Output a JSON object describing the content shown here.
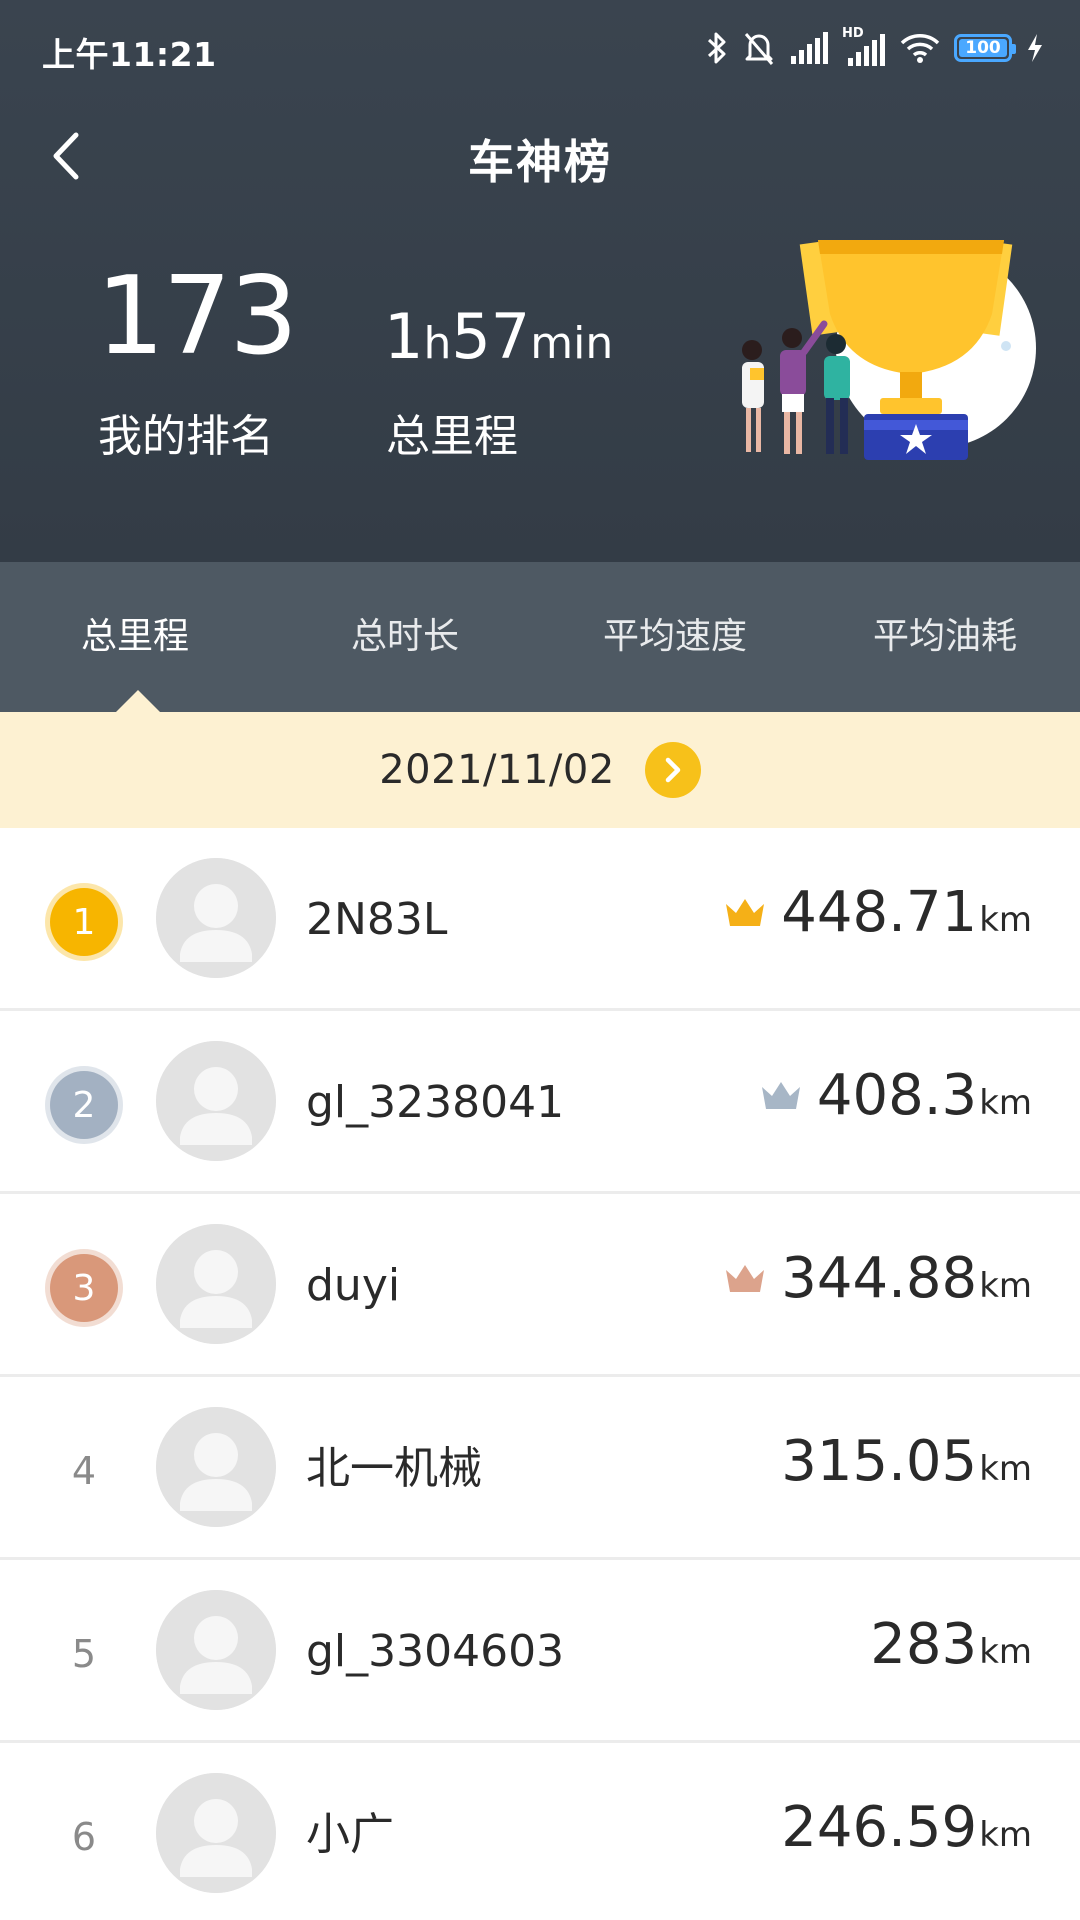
{
  "status_bar": {
    "time": "上午11:21",
    "hd_label": "HD",
    "battery": "100",
    "icons": [
      "bluetooth-icon",
      "mute-icon",
      "signal-icon",
      "hd-signal-icon",
      "wifi-icon",
      "battery-icon",
      "charging-icon"
    ]
  },
  "header": {
    "title": "车神榜",
    "back_icon": "chevron-left-icon"
  },
  "stats": {
    "rank_value": "173",
    "rank_label": "我的排名",
    "time_hours": "1",
    "time_h_unit": "h",
    "time_minutes": "57",
    "time_min_unit": "min",
    "time_label": "总里程"
  },
  "tabs": [
    {
      "label": "总里程",
      "active": true
    },
    {
      "label": "总时长",
      "active": false
    },
    {
      "label": "平均速度",
      "active": false
    },
    {
      "label": "平均油耗",
      "active": false
    }
  ],
  "date_bar": {
    "date": "2021/11/02",
    "next_icon": "chevron-right-icon"
  },
  "ranking": [
    {
      "rank": "1",
      "name": "2N83L",
      "value": "448.71",
      "unit": "km",
      "badge_color": "#f7b500",
      "crown_color": "#f5b017"
    },
    {
      "rank": "2",
      "name": "gl_3238041",
      "value": "408.3",
      "unit": "km",
      "badge_color": "#a3b1c2",
      "crown_color": "#a7b6c6"
    },
    {
      "rank": "3",
      "name": "duyi",
      "value": "344.88",
      "unit": "km",
      "badge_color": "#d9987a",
      "crown_color": "#dca38c"
    },
    {
      "rank": "4",
      "name": "北一机械",
      "value": "315.05",
      "unit": "km"
    },
    {
      "rank": "5",
      "name": "gl_3304603",
      "value": "283",
      "unit": "km"
    },
    {
      "rank": "6",
      "name": "小广",
      "value": "246.59",
      "unit": "km"
    }
  ],
  "colors": {
    "header_bg": "#36404a",
    "tabs_bg": "#4e5963",
    "date_bar_bg": "#fdf1d2",
    "accent": "#f7c11a"
  }
}
